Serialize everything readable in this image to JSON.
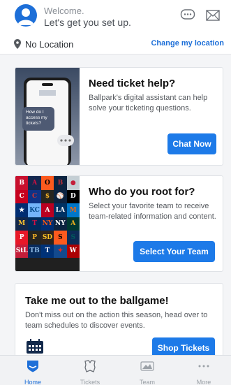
{
  "header": {
    "welcome": "Welcome.",
    "subtitle": "Let's get you set up."
  },
  "location": {
    "current": "No Location",
    "change_label": "Change my location"
  },
  "cards": [
    {
      "title": "Need ticket help?",
      "desc": "Ballpark's digital assistant can help solve your ticketing questions.",
      "button": "Chat Now",
      "chat_bubble": "How do I access my tickets?"
    },
    {
      "title": "Who do you root for?",
      "desc": "Select your favorite team to receive team-related information and content.",
      "button": "Select Your Team"
    },
    {
      "title": "Take me out to the ballgame!",
      "desc": "Don't miss out on the action this season, head over to team schedules to discover events.",
      "button": "Shop Tickets"
    }
  ],
  "tabs": [
    {
      "label": "Home",
      "icon": "shield-icon",
      "active": true
    },
    {
      "label": "Tickets",
      "icon": "ticket-icon",
      "active": false
    },
    {
      "label": "Team",
      "icon": "team-icon",
      "active": false
    },
    {
      "label": "More",
      "icon": "more-dots-icon",
      "active": false
    }
  ],
  "colors": {
    "accent": "#1d7ae8",
    "link": "#1d6fd8",
    "tab_inactive": "#9aa0a6"
  }
}
